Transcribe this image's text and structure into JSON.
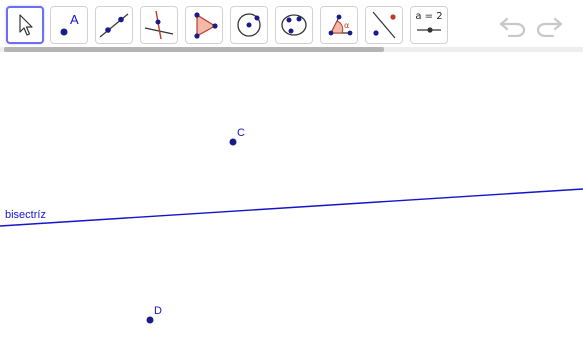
{
  "toolbar": {
    "tools": [
      {
        "name": "move-tool",
        "selected": true
      },
      {
        "name": "point-tool",
        "icon_letter": "A"
      },
      {
        "name": "line-tool"
      },
      {
        "name": "perpendicular-line-tool"
      },
      {
        "name": "polygon-tool"
      },
      {
        "name": "circle-tool"
      },
      {
        "name": "conic-tool"
      },
      {
        "name": "angle-tool",
        "icon_letter": "α"
      },
      {
        "name": "reflect-tool"
      },
      {
        "name": "slider-tool",
        "label": "a = 2"
      }
    ],
    "undo_icon": "undo-icon",
    "redo_icon": "redo-icon"
  },
  "canvas": {
    "points": [
      {
        "label": "C"
      },
      {
        "label": "D"
      }
    ],
    "line_label": "bisectríz"
  },
  "colors": {
    "point": "#1a1a8a",
    "line": "#1515c8",
    "label": "#1515c8",
    "selected_border": "#6e6ef0",
    "polygon_fill": "#f2b9a8",
    "polygon_stroke": "#c0392b"
  }
}
